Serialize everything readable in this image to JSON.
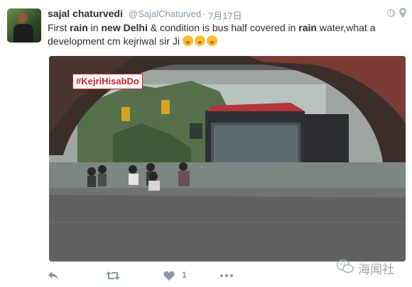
{
  "tweet": {
    "display_name": "sajal chaturvedi",
    "handle": "@SajalChaturved",
    "separator": "·",
    "date": "7月17日",
    "text_parts": [
      "First ",
      "rain",
      " in ",
      "new Delhi",
      " & condition is bus half covered in ",
      "rain",
      " water,what a development cm kejriwal sir Ji"
    ],
    "hashtag_overlay": "#KejriHisabDo",
    "like_count": "1"
  },
  "icons": {
    "globe": "globe-icon",
    "pin": "location-pin-icon",
    "reply": "reply-icon",
    "retweet": "retweet-icon",
    "like": "heart-icon",
    "more": "more-dots-icon"
  },
  "watermark": {
    "text": "海闻社"
  },
  "colors": {
    "action_gray": "#8899a6",
    "hashtag_red": "#c6282a"
  }
}
